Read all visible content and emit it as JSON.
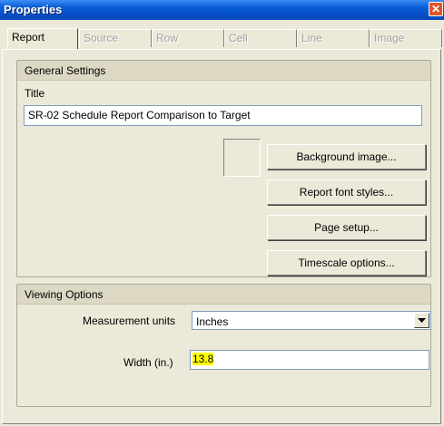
{
  "window": {
    "title": "Properties",
    "close_glyph": "✕"
  },
  "tabs": [
    {
      "label": "Report",
      "active": true
    },
    {
      "label": "Source",
      "active": false
    },
    {
      "label": "Row",
      "active": false
    },
    {
      "label": "Cell",
      "active": false
    },
    {
      "label": "Line",
      "active": false
    },
    {
      "label": "Image",
      "active": false
    }
  ],
  "general": {
    "header": "General Settings",
    "title_label": "Title",
    "title_value": "SR-02 Schedule Report Comparison to Target",
    "buttons": {
      "background_image": "Background image...",
      "report_font_styles": "Report font styles...",
      "page_setup": "Page setup...",
      "timescale_options": "Timescale options..."
    }
  },
  "viewing": {
    "header": "Viewing Options",
    "measurement_label": "Measurement units",
    "measurement_value": "Inches",
    "width_label": "Width (in.)",
    "width_value": "13.8"
  },
  "colors": {
    "titlebar": "#0a5fd8",
    "dialog_bg": "#ece9d8",
    "highlight": "#ffff00",
    "close_button": "#e2532a"
  },
  "icons": {
    "close": "close-icon",
    "dropdown": "chevron-down-icon"
  }
}
